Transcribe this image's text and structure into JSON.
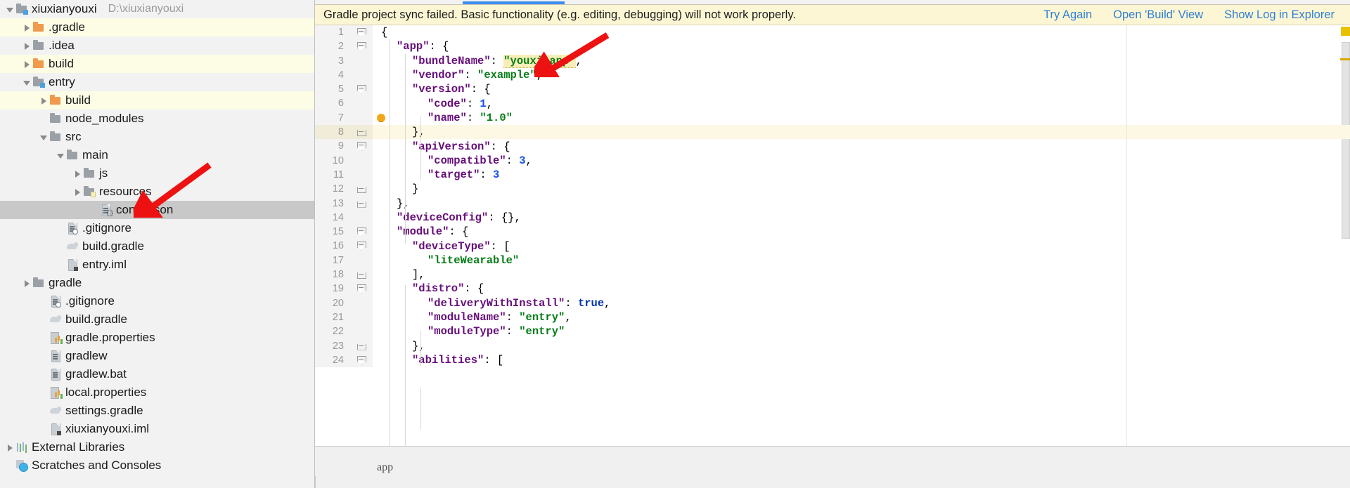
{
  "window": {
    "project_root_label": "xiuxianyouxi",
    "project_root_path": "D:\\xiuxianyouxi"
  },
  "sidebar": {
    "name": "project-tree",
    "items": [
      {
        "label": "xiuxianyouxi",
        "path": "D:\\xiuxianyouxi",
        "icon": "module-folder-icon",
        "arrow": "open",
        "depth": 0,
        "row": "grey",
        "type": "module"
      },
      {
        "label": ".gradle",
        "path": "",
        "icon": "folder-orange-icon",
        "arrow": "closed",
        "depth": 1,
        "row": "yellow",
        "type": "folder"
      },
      {
        "label": ".idea",
        "path": "",
        "icon": "folder-icon",
        "arrow": "closed",
        "depth": 1,
        "row": "grey",
        "type": "folder"
      },
      {
        "label": "build",
        "path": "",
        "icon": "folder-orange-icon",
        "arrow": "closed",
        "depth": 1,
        "row": "yellow",
        "type": "folder"
      },
      {
        "label": "entry",
        "path": "",
        "icon": "module-folder-icon",
        "arrow": "open",
        "depth": 1,
        "row": "grey",
        "type": "module"
      },
      {
        "label": "build",
        "path": "",
        "icon": "folder-orange-icon",
        "arrow": "closed",
        "depth": 2,
        "row": "yellow",
        "type": "folder"
      },
      {
        "label": "node_modules",
        "path": "",
        "icon": "folder-icon",
        "arrow": "none",
        "depth": 2,
        "row": "grey",
        "type": "folder"
      },
      {
        "label": "src",
        "path": "",
        "icon": "folder-icon",
        "arrow": "open",
        "depth": 2,
        "row": "grey",
        "type": "folder"
      },
      {
        "label": "main",
        "path": "",
        "icon": "folder-icon",
        "arrow": "open",
        "depth": 3,
        "row": "grey",
        "type": "folder"
      },
      {
        "label": "js",
        "path": "",
        "icon": "folder-icon",
        "arrow": "closed",
        "depth": 4,
        "row": "grey",
        "type": "folder"
      },
      {
        "label": "resources",
        "path": "",
        "icon": "resources-folder-icon",
        "arrow": "closed",
        "depth": 4,
        "row": "grey",
        "type": "folder"
      },
      {
        "label": "config.json",
        "path": "",
        "icon": "json-file-icon",
        "arrow": "none",
        "depth": 5,
        "row": "selected",
        "type": "file"
      },
      {
        "label": ".gitignore",
        "path": "",
        "icon": "gitignore-file-icon",
        "arrow": "none",
        "depth": 3,
        "row": "grey",
        "type": "file"
      },
      {
        "label": "build.gradle",
        "path": "",
        "icon": "gradle-file-icon",
        "arrow": "none",
        "depth": 3,
        "row": "grey",
        "type": "file"
      },
      {
        "label": "entry.iml",
        "path": "",
        "icon": "iml-file-icon",
        "arrow": "none",
        "depth": 3,
        "row": "grey",
        "type": "file"
      },
      {
        "label": "gradle",
        "path": "",
        "icon": "folder-icon",
        "arrow": "closed",
        "depth": 1,
        "row": "grey",
        "type": "folder"
      },
      {
        "label": ".gitignore",
        "path": "",
        "icon": "gitignore-file-icon",
        "arrow": "none",
        "depth": 2,
        "row": "grey",
        "type": "file"
      },
      {
        "label": "build.gradle",
        "path": "",
        "icon": "gradle-file-icon",
        "arrow": "none",
        "depth": 2,
        "row": "grey",
        "type": "file"
      },
      {
        "label": "gradle.properties",
        "path": "",
        "icon": "properties-file-icon",
        "arrow": "none",
        "depth": 2,
        "row": "grey",
        "type": "file"
      },
      {
        "label": "gradlew",
        "path": "",
        "icon": "text-file-icon",
        "arrow": "none",
        "depth": 2,
        "row": "grey",
        "type": "file"
      },
      {
        "label": "gradlew.bat",
        "path": "",
        "icon": "text-file-icon",
        "arrow": "none",
        "depth": 2,
        "row": "grey",
        "type": "file"
      },
      {
        "label": "local.properties",
        "path": "",
        "icon": "properties-file-icon",
        "arrow": "none",
        "depth": 2,
        "row": "grey",
        "type": "file"
      },
      {
        "label": "settings.gradle",
        "path": "",
        "icon": "gradle-file-icon",
        "arrow": "none",
        "depth": 2,
        "row": "grey",
        "type": "file"
      },
      {
        "label": "xiuxianyouxi.iml",
        "path": "",
        "icon": "iml-file-icon",
        "arrow": "none",
        "depth": 2,
        "row": "grey",
        "type": "file"
      },
      {
        "label": "External Libraries",
        "path": "",
        "icon": "libraries-icon",
        "arrow": "closed",
        "depth": 0,
        "row": "grey",
        "type": "node"
      },
      {
        "label": "Scratches and Consoles",
        "path": "",
        "icon": "scratches-icon",
        "arrow": "none",
        "depth": 0,
        "row": "grey",
        "type": "node"
      }
    ]
  },
  "notification": {
    "message": "Gradle project sync failed. Basic functionality (e.g. editing, debugging) will not work properly.",
    "actions": [
      {
        "label": "Try Again"
      },
      {
        "label": "Open 'Build' View"
      },
      {
        "label": "Show Log in Explorer"
      }
    ],
    "bg_color": "#fcf6d4",
    "link_color": "#2f7fd6"
  },
  "editor": {
    "file_name": "config.json",
    "highlighted_line": 8,
    "bulb_line": 7,
    "breadcrumb": "app",
    "lines": [
      {
        "n": 1,
        "indent": 0,
        "fold": "open",
        "tokens": [
          {
            "t": "punc",
            "v": "{"
          }
        ]
      },
      {
        "n": 2,
        "indent": 1,
        "fold": "open",
        "tokens": [
          {
            "t": "key",
            "v": "\"app\""
          },
          {
            "t": "punc",
            "v": ": {"
          }
        ]
      },
      {
        "n": 3,
        "indent": 2,
        "fold": "",
        "tokens": [
          {
            "t": "key",
            "v": "\"bundleName\""
          },
          {
            "t": "punc",
            "v": ": "
          },
          {
            "t": "hlstr",
            "v": "\"youxi.app\""
          },
          {
            "t": "punc",
            "v": ","
          }
        ]
      },
      {
        "n": 4,
        "indent": 2,
        "fold": "",
        "tokens": [
          {
            "t": "key",
            "v": "\"vendor\""
          },
          {
            "t": "punc",
            "v": ": "
          },
          {
            "t": "str",
            "v": "\"example\""
          },
          {
            "t": "punc",
            "v": ","
          }
        ]
      },
      {
        "n": 5,
        "indent": 2,
        "fold": "open",
        "tokens": [
          {
            "t": "key",
            "v": "\"version\""
          },
          {
            "t": "punc",
            "v": ": {"
          }
        ]
      },
      {
        "n": 6,
        "indent": 3,
        "fold": "",
        "tokens": [
          {
            "t": "key",
            "v": "\"code\""
          },
          {
            "t": "punc",
            "v": ": "
          },
          {
            "t": "num",
            "v": "1"
          },
          {
            "t": "punc",
            "v": ","
          }
        ]
      },
      {
        "n": 7,
        "indent": 3,
        "fold": "",
        "tokens": [
          {
            "t": "key",
            "v": "\"name\""
          },
          {
            "t": "punc",
            "v": ": "
          },
          {
            "t": "str",
            "v": "\"1.0\""
          }
        ]
      },
      {
        "n": 8,
        "indent": 2,
        "fold": "close",
        "tokens": [
          {
            "t": "punc",
            "v": "},"
          }
        ]
      },
      {
        "n": 9,
        "indent": 2,
        "fold": "open",
        "tokens": [
          {
            "t": "key",
            "v": "\"apiVersion\""
          },
          {
            "t": "punc",
            "v": ": {"
          }
        ]
      },
      {
        "n": 10,
        "indent": 3,
        "fold": "",
        "tokens": [
          {
            "t": "key",
            "v": "\"compatible\""
          },
          {
            "t": "punc",
            "v": ": "
          },
          {
            "t": "num",
            "v": "3"
          },
          {
            "t": "punc",
            "v": ","
          }
        ]
      },
      {
        "n": 11,
        "indent": 3,
        "fold": "",
        "tokens": [
          {
            "t": "key",
            "v": "\"target\""
          },
          {
            "t": "punc",
            "v": ": "
          },
          {
            "t": "num",
            "v": "3"
          }
        ]
      },
      {
        "n": 12,
        "indent": 2,
        "fold": "close",
        "tokens": [
          {
            "t": "punc",
            "v": "}"
          }
        ]
      },
      {
        "n": 13,
        "indent": 1,
        "fold": "close",
        "tokens": [
          {
            "t": "punc",
            "v": "},"
          }
        ]
      },
      {
        "n": 14,
        "indent": 1,
        "fold": "",
        "tokens": [
          {
            "t": "key",
            "v": "\"deviceConfig\""
          },
          {
            "t": "punc",
            "v": ": {},"
          }
        ]
      },
      {
        "n": 15,
        "indent": 1,
        "fold": "open",
        "tokens": [
          {
            "t": "key",
            "v": "\"module\""
          },
          {
            "t": "punc",
            "v": ": {"
          }
        ]
      },
      {
        "n": 16,
        "indent": 2,
        "fold": "open",
        "tokens": [
          {
            "t": "key",
            "v": "\"deviceType\""
          },
          {
            "t": "punc",
            "v": ": ["
          }
        ]
      },
      {
        "n": 17,
        "indent": 3,
        "fold": "",
        "tokens": [
          {
            "t": "str",
            "v": "\"liteWearable\""
          }
        ]
      },
      {
        "n": 18,
        "indent": 2,
        "fold": "close",
        "tokens": [
          {
            "t": "punc",
            "v": "],"
          }
        ]
      },
      {
        "n": 19,
        "indent": 2,
        "fold": "open",
        "tokens": [
          {
            "t": "key",
            "v": "\"distro\""
          },
          {
            "t": "punc",
            "v": ": {"
          }
        ]
      },
      {
        "n": 20,
        "indent": 3,
        "fold": "",
        "tokens": [
          {
            "t": "key",
            "v": "\"deliveryWithInstall\""
          },
          {
            "t": "punc",
            "v": ": "
          },
          {
            "t": "bool",
            "v": "true"
          },
          {
            "t": "punc",
            "v": ","
          }
        ]
      },
      {
        "n": 21,
        "indent": 3,
        "fold": "",
        "tokens": [
          {
            "t": "key",
            "v": "\"moduleName\""
          },
          {
            "t": "punc",
            "v": ": "
          },
          {
            "t": "str",
            "v": "\"entry\""
          },
          {
            "t": "punc",
            "v": ","
          }
        ]
      },
      {
        "n": 22,
        "indent": 3,
        "fold": "",
        "tokens": [
          {
            "t": "key",
            "v": "\"moduleType\""
          },
          {
            "t": "punc",
            "v": ": "
          },
          {
            "t": "str",
            "v": "\"entry\""
          }
        ]
      },
      {
        "n": 23,
        "indent": 2,
        "fold": "close",
        "tokens": [
          {
            "t": "punc",
            "v": "},"
          }
        ]
      },
      {
        "n": 24,
        "indent": 2,
        "fold": "open",
        "tokens": [
          {
            "t": "key",
            "v": "\"abilities\""
          },
          {
            "t": "punc",
            "v": ": ["
          }
        ]
      }
    ]
  },
  "annotations": {
    "arrow_color": "#ee1111",
    "arrows": [
      {
        "name": "arrow-to-bundle-name-value"
      },
      {
        "name": "arrow-to-config-json-file"
      }
    ]
  },
  "colors": {
    "selection_grey": "#c8c8c8",
    "row_yellow": "#fdfce4",
    "highlight_line": "#fdf8e3",
    "key_purple": "#660e7a",
    "string_green": "#067d17",
    "number_blue": "#1750eb"
  }
}
